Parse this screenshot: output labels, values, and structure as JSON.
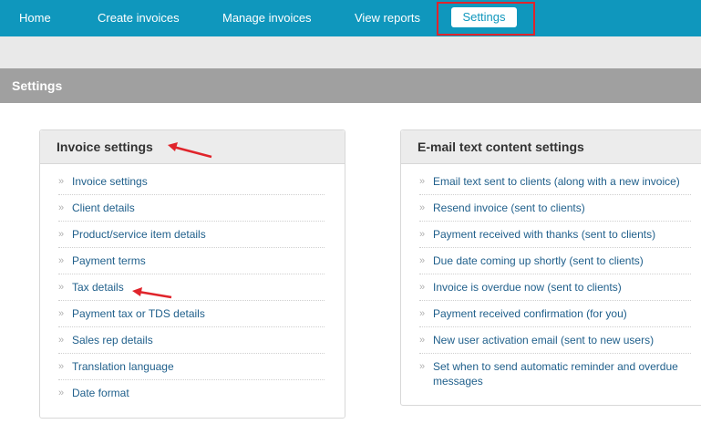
{
  "nav": {
    "items": [
      "Home",
      "Create invoices",
      "Manage invoices",
      "View reports"
    ],
    "active": "Settings"
  },
  "section": {
    "title": "Settings"
  },
  "invoice_panel": {
    "title": "Invoice settings",
    "items": [
      "Invoice settings",
      "Client details",
      "Product/service item details",
      "Payment terms",
      "Tax details",
      "Payment tax or TDS details",
      "Sales rep details",
      "Translation language",
      "Date format"
    ]
  },
  "email_panel": {
    "title": "E-mail text content settings",
    "items": [
      "Email text sent to clients (along with a new invoice)",
      "Resend invoice (sent to clients)",
      "Payment received with thanks (sent to clients)",
      "Due date coming up shortly (sent to clients)",
      "Invoice is overdue now (sent to clients)",
      "Payment received confirmation (for you)",
      "New user activation email (sent to new users)",
      "Set when to send automatic reminder and overdue messages"
    ]
  },
  "colors": {
    "nav_bg": "#0f97bd",
    "link": "#1f5f8b",
    "annotation_red": "#e0242b",
    "section_bar": "#a0a0a0"
  }
}
